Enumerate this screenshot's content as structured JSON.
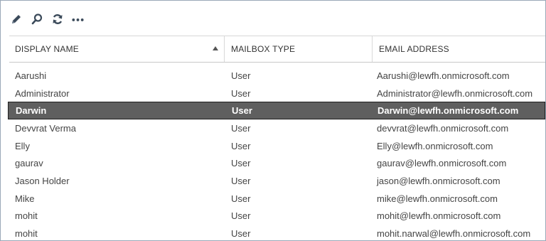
{
  "toolbar": {
    "icons": [
      "pencil-edit-icon",
      "search-icon",
      "refresh-icon",
      "more-options-icon"
    ]
  },
  "table": {
    "columns": {
      "display_name": "DISPLAY NAME",
      "mailbox_type": "MAILBOX TYPE",
      "email_address": "EMAIL ADDRESS"
    },
    "sort": {
      "column": "display_name",
      "direction": "ascending"
    },
    "rows": [
      {
        "name": "Aarushi",
        "type": "User",
        "email": "Aarushi@lewfh.onmicrosoft.com"
      },
      {
        "name": "Administrator",
        "type": "User",
        "email": "Administrator@lewfh.onmicrosoft.com"
      },
      {
        "name": "Darwin",
        "type": "User",
        "email": "Darwin@lewfh.onmicrosoft.com"
      },
      {
        "name": "Devvrat Verma",
        "type": "User",
        "email": "devvrat@lewfh.onmicrosoft.com"
      },
      {
        "name": "Elly",
        "type": "User",
        "email": "Elly@lewfh.onmicrosoft.com"
      },
      {
        "name": "gaurav",
        "type": "User",
        "email": "gaurav@lewfh.onmicrosoft.com"
      },
      {
        "name": "Jason Holder",
        "type": "User",
        "email": "jason@lewfh.onmicrosoft.com"
      },
      {
        "name": "Mike",
        "type": "User",
        "email": "mike@lewfh.onmicrosoft.com"
      },
      {
        "name": "mohit",
        "type": "User",
        "email": "mohit@lewfh.onmicrosoft.com"
      },
      {
        "name": "mohit",
        "type": "User",
        "email": "mohit.narwal@lewfh.onmicrosoft.com"
      }
    ],
    "selected_row": 2
  },
  "colors": {
    "selected_background": "#5f5f5f",
    "selected_text": "#ffffff",
    "icon": "#3b4a5a"
  }
}
